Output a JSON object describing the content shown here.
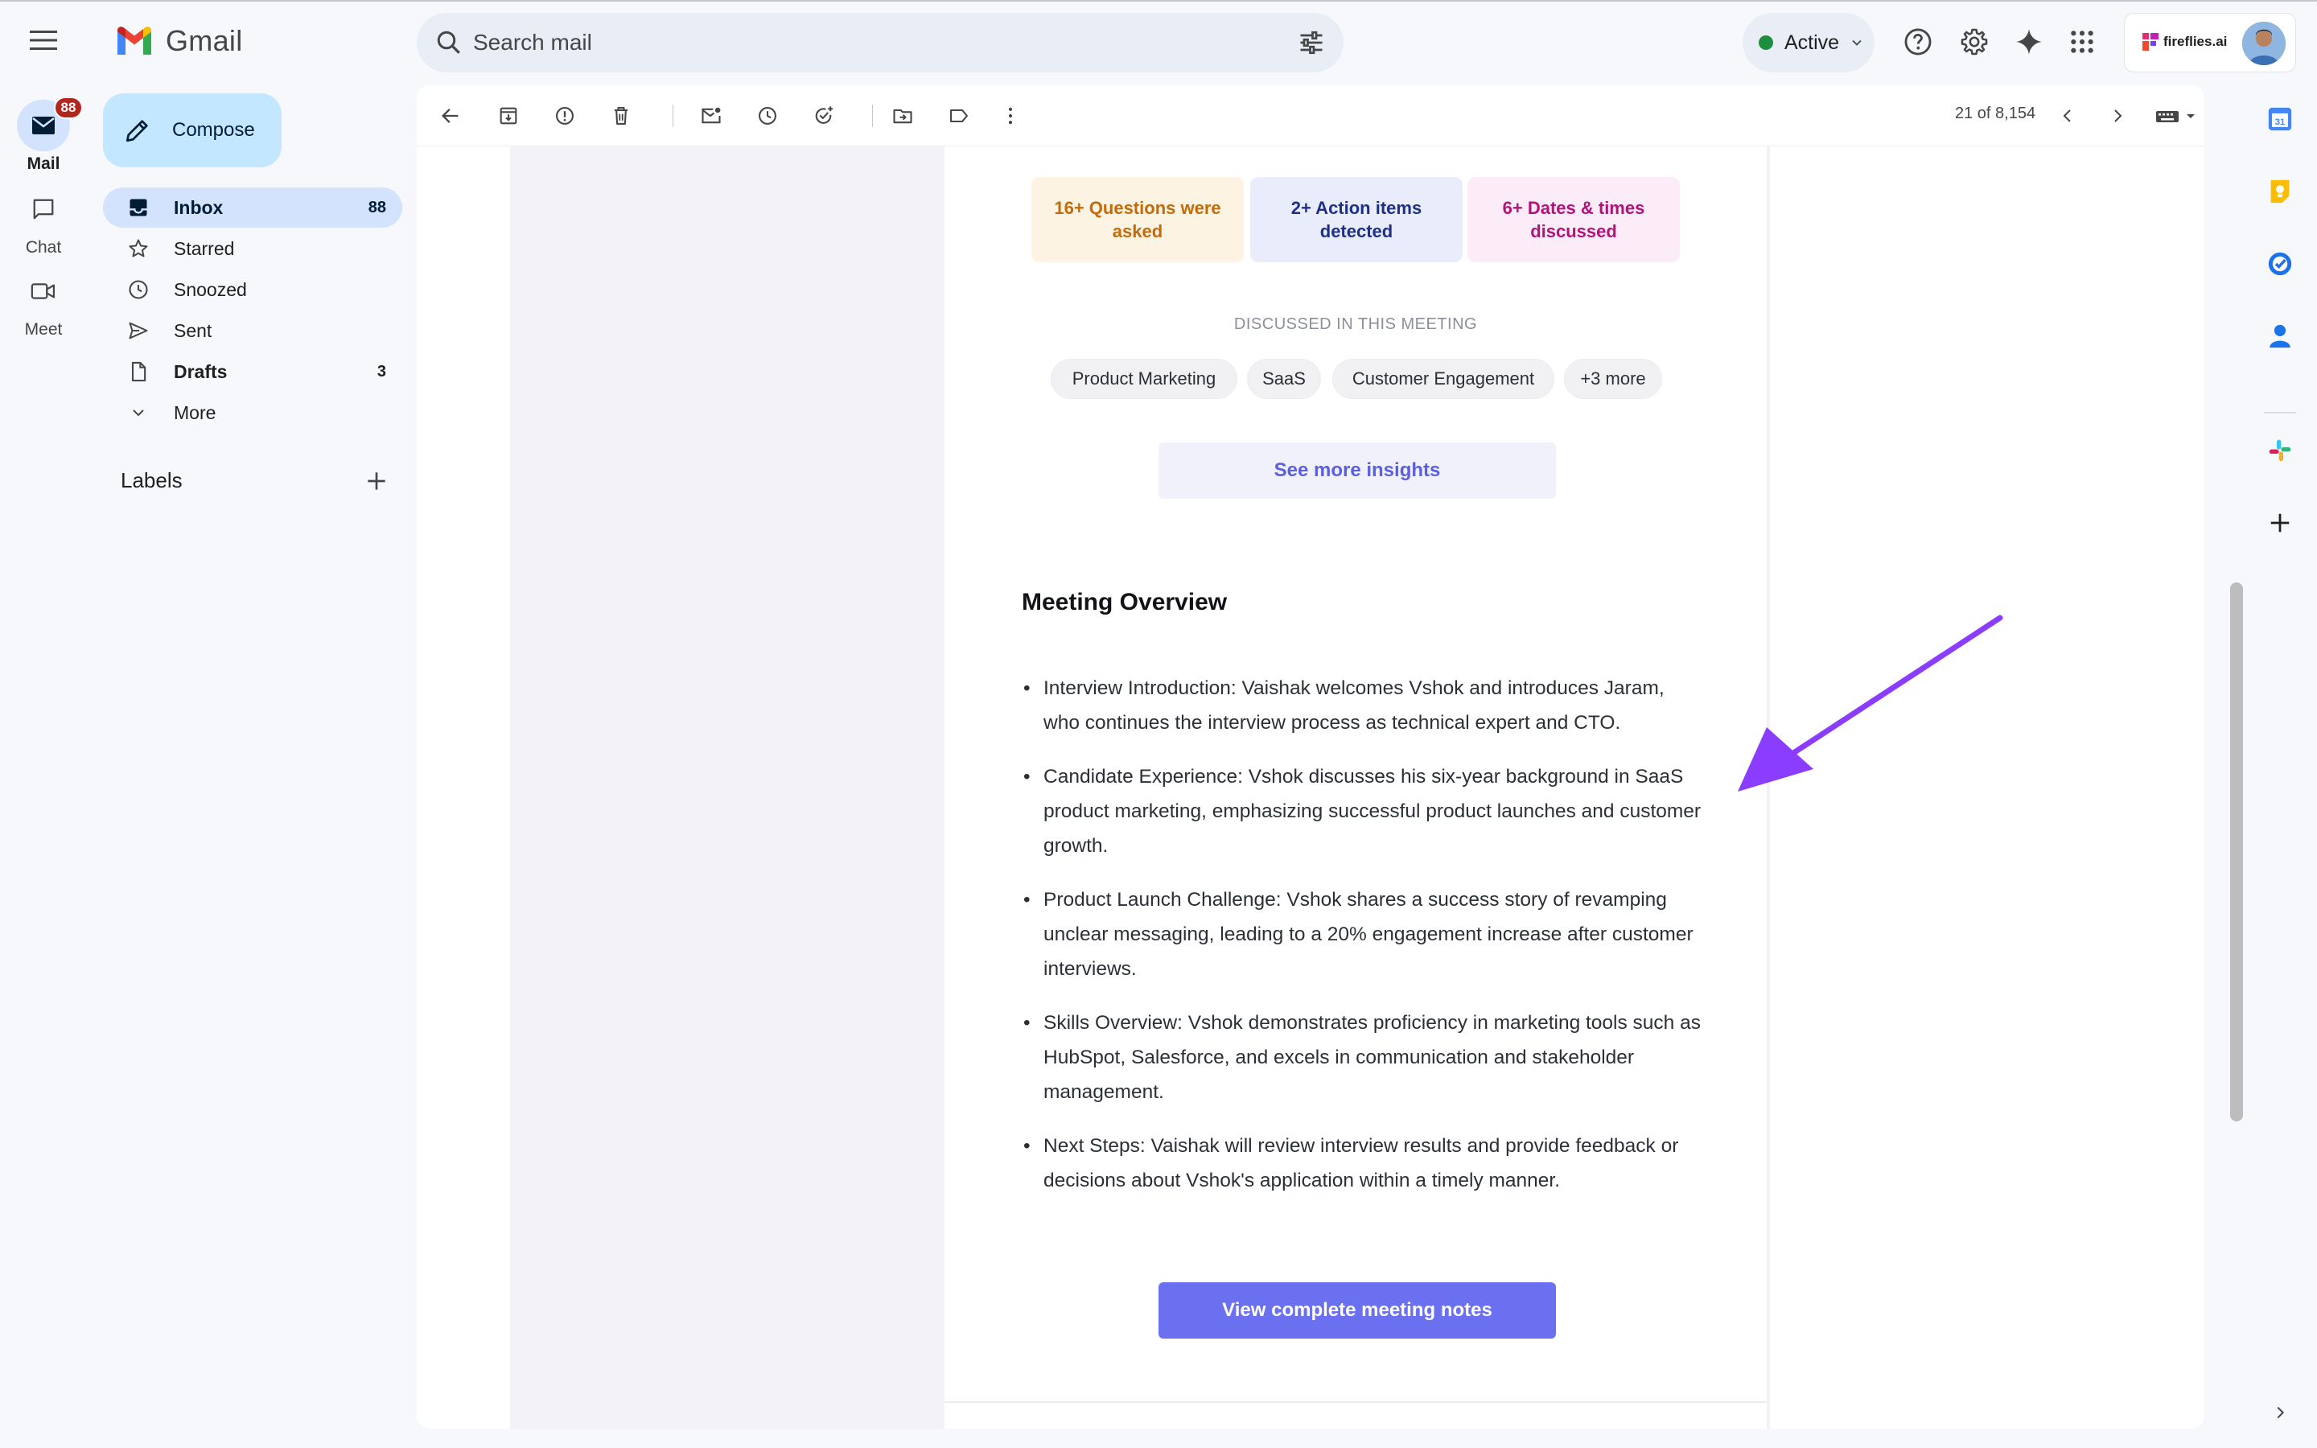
{
  "app": {
    "name": "Gmail",
    "search_placeholder": "Search mail",
    "status": "Active",
    "account_brand": "fireflies.ai"
  },
  "rail": {
    "mail": {
      "label": "Mail",
      "badge": "88"
    },
    "chat": {
      "label": "Chat"
    },
    "meet": {
      "label": "Meet"
    }
  },
  "nav": {
    "compose": "Compose",
    "items": [
      {
        "label": "Inbox",
        "count": "88"
      },
      {
        "label": "Starred",
        "count": ""
      },
      {
        "label": "Snoozed",
        "count": ""
      },
      {
        "label": "Sent",
        "count": ""
      },
      {
        "label": "Drafts",
        "count": "3"
      },
      {
        "label": "More",
        "count": ""
      }
    ],
    "labels_heading": "Labels"
  },
  "toolbar": {
    "pager": "21 of 8,154"
  },
  "email": {
    "metrics": {
      "questions": "16+ Questions were asked",
      "actions": "2+ Action items detected",
      "dates": "6+ Dates & times discussed"
    },
    "discussed_heading": "DISCUSSED IN THIS MEETING",
    "topics": [
      "Product Marketing",
      "SaaS",
      "Customer Engagement",
      "+3 more"
    ],
    "insights_button": "See more insights",
    "overview_title": "Meeting Overview",
    "overview": [
      "Interview Introduction: Vaishak welcomes Vshok and introduces Jaram, who continues the interview process as technical expert and CTO.",
      "Candidate Experience: Vshok discusses his six-year background in SaaS product marketing, emphasizing successful product launches and customer growth.",
      "Product Launch Challenge: Vshok shares a success story of revamping unclear messaging, leading to a 20% engagement increase after customer interviews.",
      "Skills Overview: Vshok demonstrates proficiency in marketing tools such as HubSpot, Salesforce, and excels in communication and stakeholder management.",
      "Next Steps: Vaishak will review interview results and provide feedback or decisions about Vshok's application within a timely manner."
    ],
    "notes_button": "View complete meeting notes"
  },
  "colors": {
    "accent": "#6b70f0",
    "annotation_arrow": "#8b3dff",
    "compose_bg": "#c2e7ff",
    "active_nav": "#d3e3fd"
  }
}
